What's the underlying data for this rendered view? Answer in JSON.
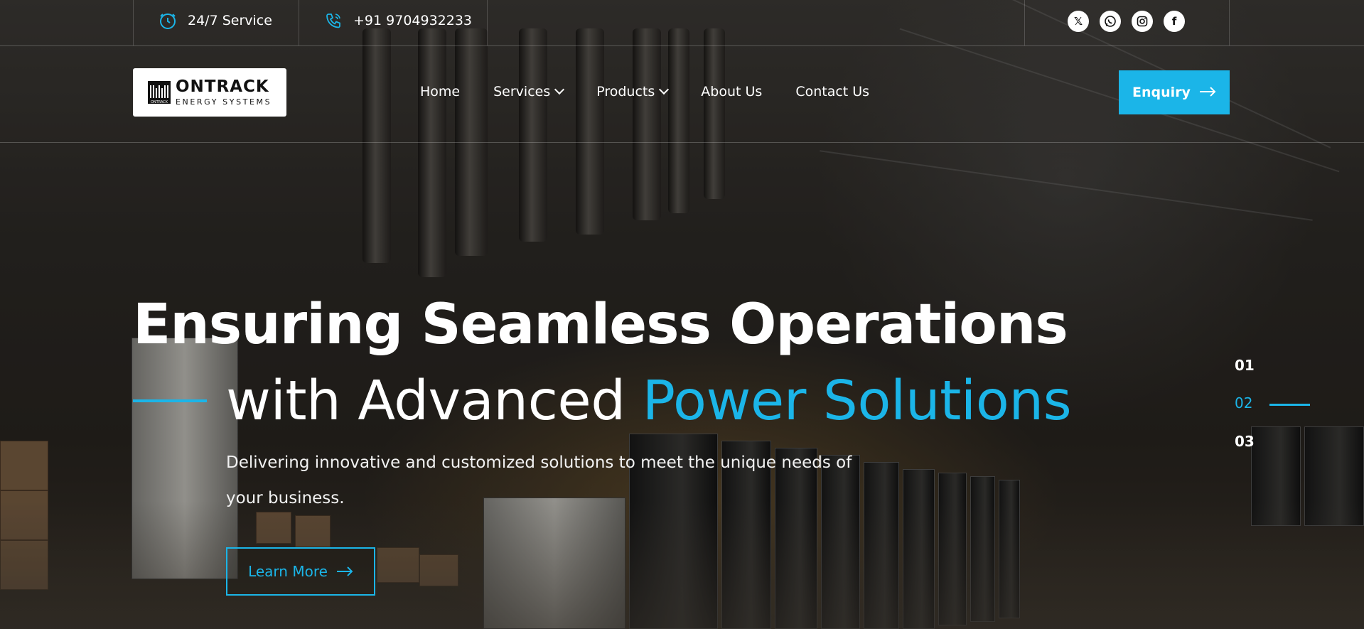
{
  "topbar": {
    "service_label": "24/7 Service",
    "phone": "+91 9704932233",
    "socials": [
      {
        "name": "x-twitter-icon",
        "glyph": "𝕏"
      },
      {
        "name": "whatsapp-icon",
        "glyph": "◎"
      },
      {
        "name": "instagram-icon",
        "glyph": "◘"
      },
      {
        "name": "facebook-icon",
        "glyph": "f"
      }
    ]
  },
  "logo": {
    "main": "ONTRACK",
    "sub": "ENERGY SYSTEMS",
    "mark_text": "ONTRACK"
  },
  "nav": {
    "items": [
      {
        "label": "Home",
        "has_dropdown": false
      },
      {
        "label": "Services",
        "has_dropdown": true
      },
      {
        "label": "Products",
        "has_dropdown": true
      },
      {
        "label": "About Us",
        "has_dropdown": false
      },
      {
        "label": "Contact Us",
        "has_dropdown": false
      }
    ],
    "cta_label": "Enquiry"
  },
  "hero": {
    "title_line1": "Ensuring Seamless Operations",
    "title_line2_plain": "with Advanced ",
    "title_line2_accent": "Power Solutions",
    "description": "Delivering innovative and customized solutions to meet the unique needs of your business.",
    "button_label": "Learn More"
  },
  "pager": {
    "items": [
      "01",
      "02",
      "03"
    ],
    "active_index": 1
  },
  "colors": {
    "accent": "#1bb5e8",
    "text": "#ffffff"
  }
}
